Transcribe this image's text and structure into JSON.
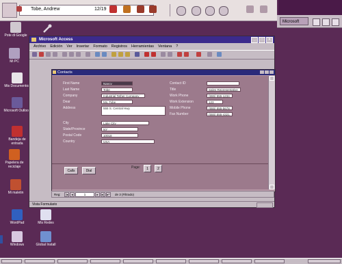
{
  "topbar": {
    "address_text": "Tobe, Andrew",
    "date_text": "12/19"
  },
  "tray": {
    "button_label": "Microsoft"
  },
  "desktop_icons": [
    {
      "label": "Pote di Google"
    },
    {
      "label": "Mi PC"
    },
    {
      "label": "Mis Documentos"
    },
    {
      "label": "Outlook"
    },
    {
      "label": "Microsoft Outlook"
    },
    {
      "label": "Bandeja de entrada"
    },
    {
      "label": "Papelera de reciclaje"
    },
    {
      "label": "Mi maletin"
    },
    {
      "label": "WordPad"
    },
    {
      "label": "Mis Redes"
    },
    {
      "label": "Windows"
    },
    {
      "label": "Global Install"
    }
  ],
  "access": {
    "title": "Microsoft Access",
    "menu": [
      "Archivo",
      "Edición",
      "Ver",
      "Insertar",
      "Formato",
      "Registros",
      "Herramientas",
      "Ventana",
      "?"
    ],
    "form_title": "Contacts",
    "left_fields": [
      {
        "label": "First Name",
        "value": "Nancy"
      },
      {
        "label": "Last Name",
        "value": "Tobe"
      },
      {
        "label": "Company",
        "value": "Industrial Tether Company"
      },
      {
        "label": "Dear",
        "value": "Ms. Tobe"
      },
      {
        "label": "Address",
        "value": "555 S. Central Hwy"
      },
      {
        "label": "City",
        "value": "Lake City"
      },
      {
        "label": "State/Province",
        "value": "NY"
      },
      {
        "label": "Postal Code",
        "value": "10018"
      },
      {
        "label": "Country",
        "value": "USA"
      }
    ],
    "right_fields": [
      {
        "label": "Contact ID",
        "value": ""
      },
      {
        "label": "Title",
        "value": "Sales Representative"
      },
      {
        "label": "Work Phone",
        "value": "(555) 555-1234"
      },
      {
        "label": "Work Extension",
        "value": "123"
      },
      {
        "label": "Mobile Phone",
        "value": "(555) 555-5678"
      },
      {
        "label": "Fax Number",
        "value": "(555) 555-4321"
      }
    ],
    "buttons": {
      "one": "Calls",
      "two": "Dial"
    },
    "page_label": "Page:",
    "page_buttons": [
      "1",
      "2"
    ],
    "record_nav": {
      "label": "Reg:",
      "current": "1",
      "total_text": "de 3 (Filtrado)"
    },
    "status_text": "Vista Formulario"
  }
}
